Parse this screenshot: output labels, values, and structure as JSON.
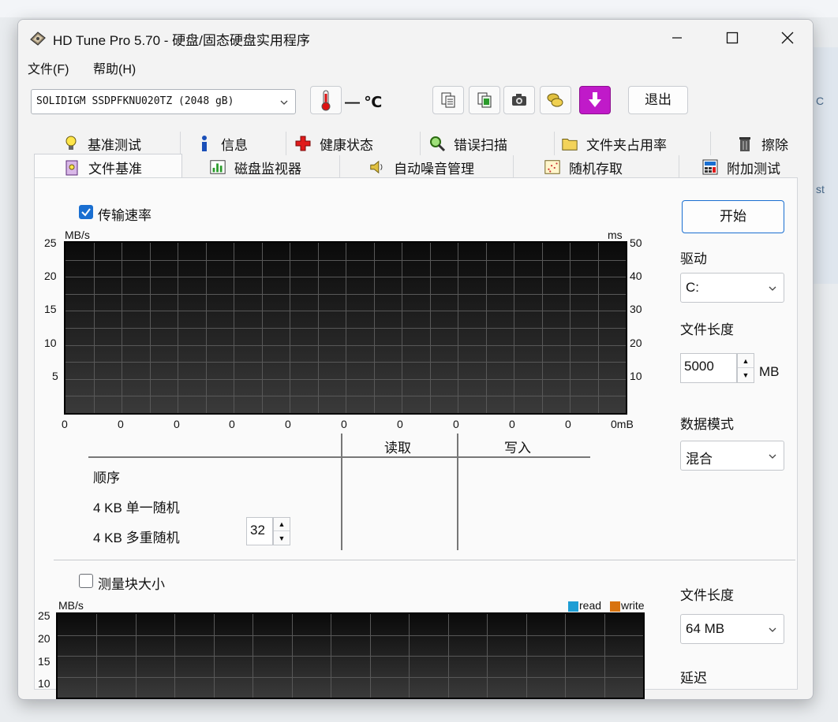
{
  "window": {
    "title": "HD Tune Pro 5.70 - 硬盘/固态硬盘实用程序"
  },
  "menu": {
    "file": "文件(F)",
    "help": "帮助(H)"
  },
  "toolbar": {
    "drive": "SOLIDIGM SSDPFKNU020TZ (2048 gB)",
    "temperature": "— ℃",
    "exit_label": "退出"
  },
  "tabs_row1": [
    "基准测试",
    "信息",
    "健康状态",
    "错误扫描",
    "文件夹占用率",
    "擦除"
  ],
  "tabs_row2": [
    "文件基准",
    "磁盘监视器",
    "自动噪音管理",
    "随机存取",
    "附加测试"
  ],
  "transfer_section": {
    "checkbox_label": "传输速率",
    "checked": true,
    "y_left_unit": "MB/s",
    "y_right_unit": "ms",
    "y_left_ticks": [
      "25",
      "20",
      "15",
      "10",
      "5"
    ],
    "y_right_ticks": [
      "50",
      "40",
      "30",
      "20",
      "10"
    ],
    "x_ticks": [
      "0",
      "0",
      "0",
      "0",
      "0",
      "0",
      "0",
      "0",
      "0",
      "0",
      "0mB"
    ]
  },
  "results_table": {
    "col_read": "读取",
    "col_write": "写入",
    "row_sequential": "顺序",
    "row_4kb_single": "4 KB 单一随机",
    "row_4kb_multi": "4 KB 多重随机",
    "queue_depth": "32"
  },
  "right_panel": {
    "start_label": "开始",
    "drive_label": "驱动",
    "drive_value": "C:",
    "file_length_label": "文件长度",
    "file_length_value": "5000",
    "file_length_unit": "MB",
    "data_mode_label": "数据模式",
    "data_mode_value": "混合",
    "file_length2_label": "文件长度",
    "file_length2_value": "64 MB",
    "delay_label": "延迟"
  },
  "block_section": {
    "checkbox_label": "测量块大小",
    "checked": false,
    "y_unit": "MB/s",
    "y_ticks": [
      "25",
      "20",
      "15",
      "10"
    ],
    "legend_read": "read",
    "legend_write": "write"
  },
  "colors": {
    "accent": "#1a6fd1",
    "read": "#1e9ed4",
    "write": "#d8730f"
  }
}
